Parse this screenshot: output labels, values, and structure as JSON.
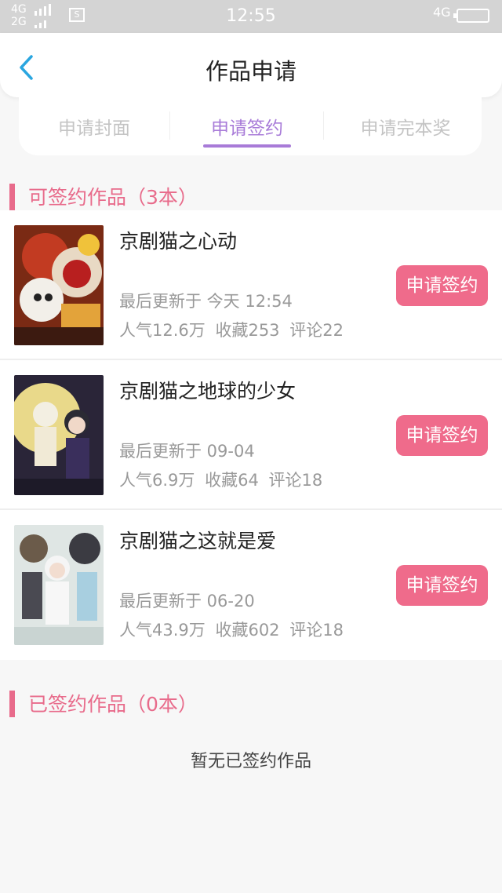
{
  "status_bar": {
    "network_top": "4G",
    "network_bottom": "2G",
    "sim_label": "S",
    "time": "12:55",
    "network_right": "4G"
  },
  "header": {
    "title": "作品申请"
  },
  "tabs": [
    {
      "label": "申请封面",
      "active": false
    },
    {
      "label": "申请签约",
      "active": true
    },
    {
      "label": "申请完本奖",
      "active": false
    }
  ],
  "signable_section": {
    "title": "可签约作品（3本）"
  },
  "works": [
    {
      "name": "京剧猫之心动",
      "updated": "最后更新于 今天 12:54",
      "popularity": "人气12.6万",
      "favorites": "收藏253",
      "comments": "评论22",
      "button": "申请签约"
    },
    {
      "name": "京剧猫之地球的少女",
      "updated": "最后更新于 09-04",
      "popularity": "人气6.9万",
      "favorites": "收藏64",
      "comments": "评论18",
      "button": "申请签约"
    },
    {
      "name": "京剧猫之这就是爱",
      "updated": "最后更新于 06-20",
      "popularity": "人气43.9万",
      "favorites": "收藏602",
      "comments": "评论18",
      "button": "申请签约"
    }
  ],
  "signed_section": {
    "title": "已签约作品（0本）",
    "empty_text": "暂无已签约作品"
  },
  "colors": {
    "accent_pink": "#ef6b8b",
    "tab_active": "#a87bd8",
    "back_arrow": "#2aa6e0"
  }
}
